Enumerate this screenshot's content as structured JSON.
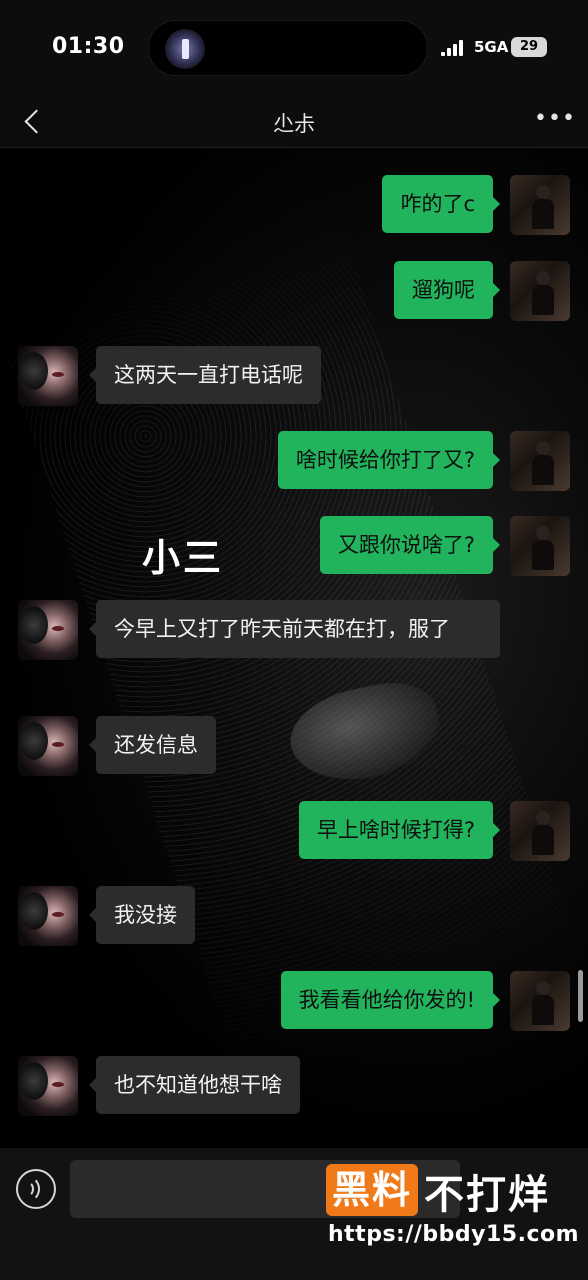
{
  "status_bar": {
    "time": "01:30",
    "network": "5GA",
    "battery": "29"
  },
  "header": {
    "title": "尐尗",
    "more_label": "•••"
  },
  "overlay_label": "小三",
  "messages": [
    {
      "side": "right",
      "text": "咋的了c"
    },
    {
      "side": "right",
      "text": "遛狗呢"
    },
    {
      "side": "left",
      "text": "这两天一直打电话呢"
    },
    {
      "side": "right",
      "text": "啥时候给你打了又?"
    },
    {
      "side": "right",
      "text": "又跟你说啥了?"
    },
    {
      "side": "left",
      "text": "今早上又打了昨天前天都在打，服了"
    },
    {
      "side": "left",
      "text": "还发信息"
    },
    {
      "side": "right",
      "text": "早上啥时候打得?"
    },
    {
      "side": "left",
      "text": "我没接"
    },
    {
      "side": "right",
      "text": "我看看他给你发的!"
    },
    {
      "side": "left",
      "text": "也不知道他想干啥"
    }
  ],
  "input": {
    "value": "",
    "placeholder": ""
  },
  "watermark": {
    "box_text": "黑料",
    "text": "不打烊",
    "url": "https://bbdy15.com"
  },
  "colors": {
    "outgoing_bubble": "#21b45c",
    "incoming_bubble": "#2c2c2c",
    "background": "#000000",
    "watermark_accent": "#f07a1a"
  }
}
